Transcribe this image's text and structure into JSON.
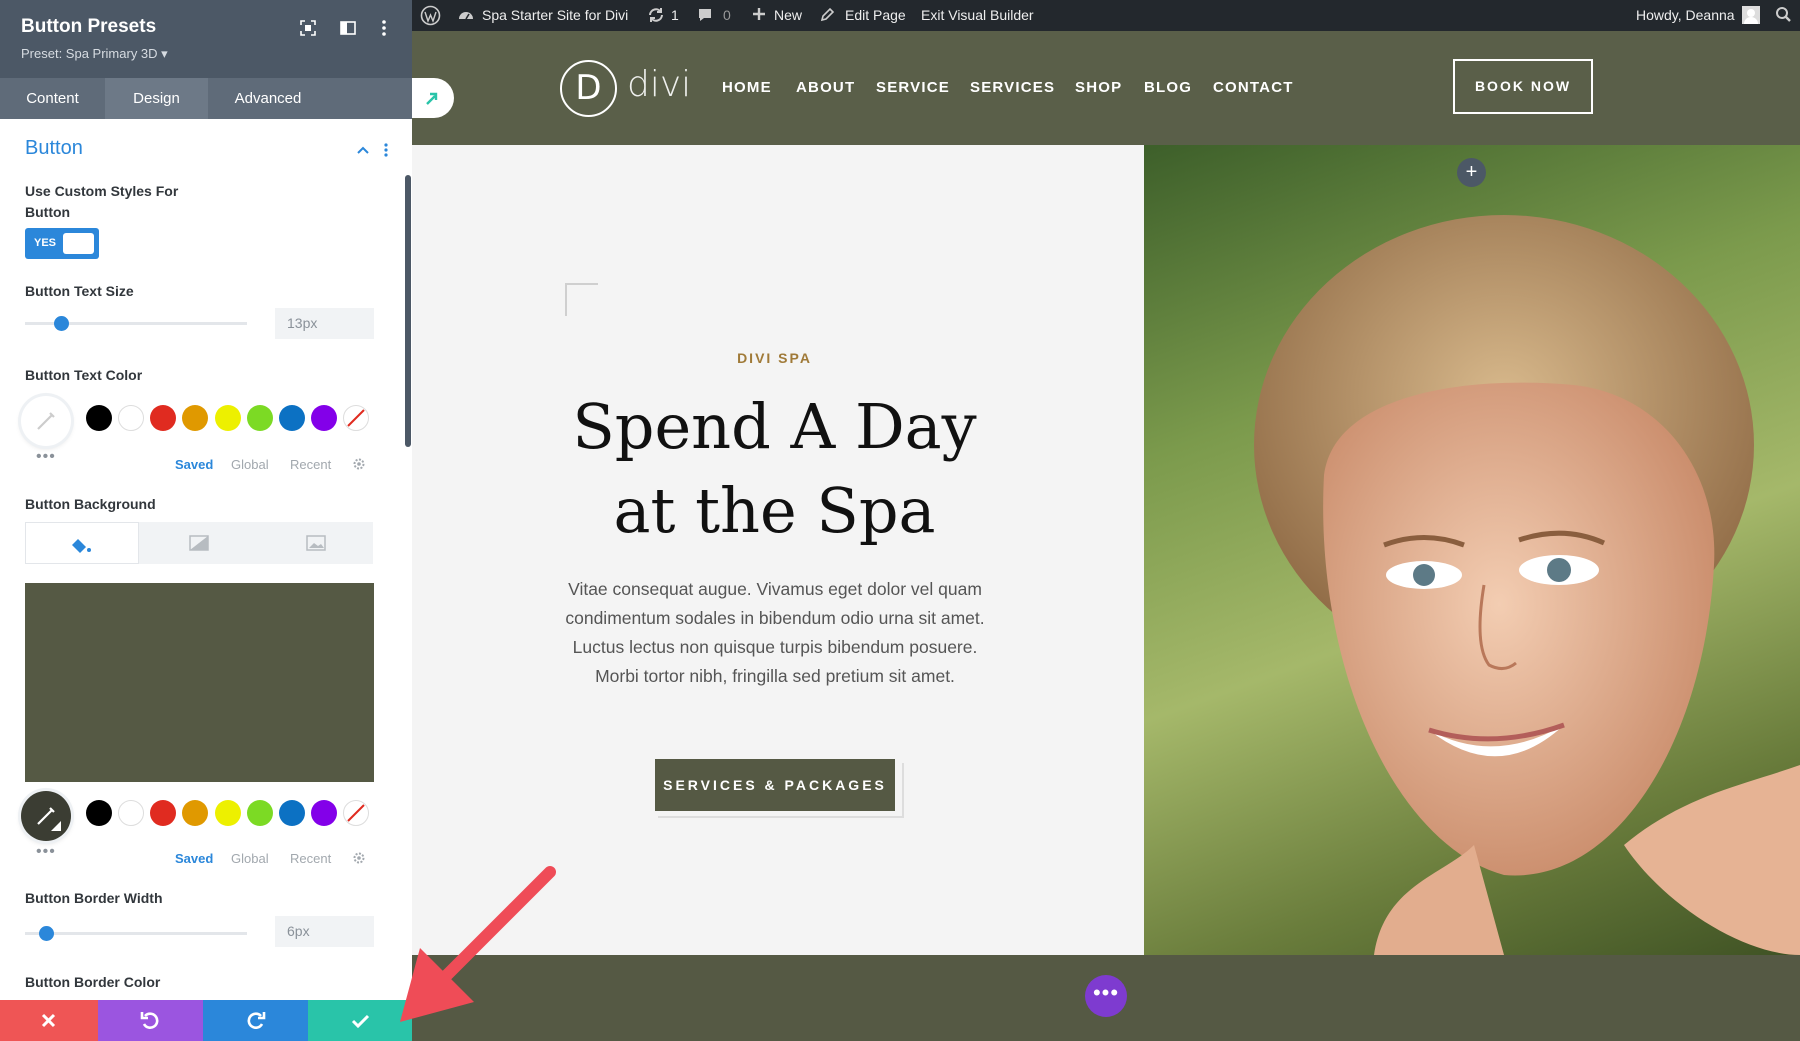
{
  "panel": {
    "title": "Button Presets",
    "preset": "Preset: Spa Primary 3D ▾",
    "tabs": [
      "Content",
      "Design",
      "Advanced"
    ],
    "active_tab": "Design",
    "section_title": "Button",
    "custom_styles_label": "Use Custom Styles For Button",
    "toggle_value": "YES",
    "text_size_label": "Button Text Size",
    "text_size_value": "13px",
    "text_size_slider": 0.14,
    "text_color_label": "Button Text Color",
    "background_label": "Button Background",
    "background_color": "#555944",
    "border_width_label": "Button Border Width",
    "border_width_value": "6px",
    "border_width_slider": 0.07,
    "border_color_label": "Button Border Color",
    "palette_links": [
      "Saved",
      "Global",
      "Recent"
    ],
    "swatch_colors": [
      "#000000",
      "#ffffff",
      "#e02b20",
      "#e09900",
      "#edf000",
      "#7cda24",
      "#0c71c3",
      "#8300e9"
    ],
    "footer_colors": [
      "#ef5555",
      "#9b55e0",
      "#2b87da",
      "#29c4a9"
    ]
  },
  "adminbar": {
    "site_name": "Spa Starter Site for Divi",
    "updates": "1",
    "comments": "0",
    "new": "New",
    "edit_page": "Edit Page",
    "exit_builder": "Exit Visual Builder",
    "howdy": "Howdy, Deanna"
  },
  "site": {
    "logo_letter": "D",
    "logo_text": "divi",
    "nav": [
      "HOME",
      "ABOUT",
      "SERVICE",
      "SERVICES",
      "SHOP",
      "BLOG",
      "CONTACT"
    ],
    "book_now": "BOOK NOW",
    "eyebrow": "DIVI SPA",
    "heading_line1": "Spend A Day",
    "heading_line2": "at the Spa",
    "body": "Vitae consequat augue. Vivamus eget dolor vel quam condimentum sodales in bibendum odio urna sit amet. Luctus lectus non quisque turpis bibendum posuere. Morbi tortor nibh, fringilla sed pretium sit amet.",
    "cta": "SERVICES & PACKAGES",
    "plus": "+",
    "more": "•••"
  }
}
